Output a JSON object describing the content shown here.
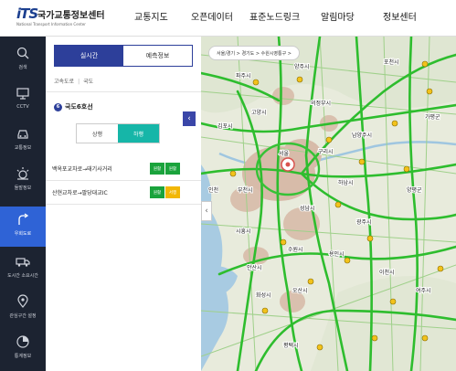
{
  "logo": {
    "mark": "ITS",
    "name_kr": "국가교통정보센터",
    "name_en": "National Transport Information Center"
  },
  "gnb": [
    "교통지도",
    "오픈데이터",
    "표준노드링크",
    "알림마당",
    "정보센터"
  ],
  "lnb": [
    {
      "label": "검색",
      "icon": "search-icon"
    },
    {
      "label": "CCTV",
      "icon": "cctv-icon"
    },
    {
      "label": "교통정보",
      "icon": "car-icon"
    },
    {
      "label": "돌발정보",
      "icon": "alert-icon"
    },
    {
      "label": "우회도로",
      "icon": "detour-icon",
      "active": true
    },
    {
      "label": "도시간 소요시간",
      "icon": "truck-icon"
    },
    {
      "label": "관심구간 설정",
      "icon": "pin-icon"
    },
    {
      "label": "통계정보",
      "icon": "stats-icon"
    }
  ],
  "panel": {
    "tab_realtime": "실시간",
    "tab_forecast": "예측정보",
    "road_types": [
      "고속도로",
      "국도"
    ],
    "route_badge": "6",
    "route_name": "국도6호선",
    "dir_up": "상행",
    "dir_down": "하행",
    "sections": [
      {
        "name": "백옥포교차로→태기사거리",
        "s1": "원활",
        "s2": "원활",
        "c1": "green",
        "c2": "green"
      },
      {
        "name": "산현교차로→팔당대교IC",
        "s1": "원활",
        "s2": "서행",
        "c1": "green",
        "c2": "yellow"
      }
    ]
  },
  "map": {
    "breadcrumb": "서울/경기 > 경기도 > 수원시영통구 >",
    "cities": [
      "파주시",
      "양주시",
      "의정부시",
      "포천시",
      "남양주시",
      "구리시",
      "하남시",
      "서울",
      "성남시",
      "광주시",
      "인천",
      "부천시",
      "시흥시",
      "안산시",
      "수원시",
      "용인시",
      "화성시",
      "오산시",
      "평택시",
      "이천시",
      "여주시",
      "양평군",
      "가평군",
      "김포시",
      "고양시"
    ],
    "colors": {
      "road_ok": "#2ebd2e",
      "road_mid": "#5fd04a",
      "urban": "#cbb0a0",
      "water": "#9fc6e0"
    }
  }
}
